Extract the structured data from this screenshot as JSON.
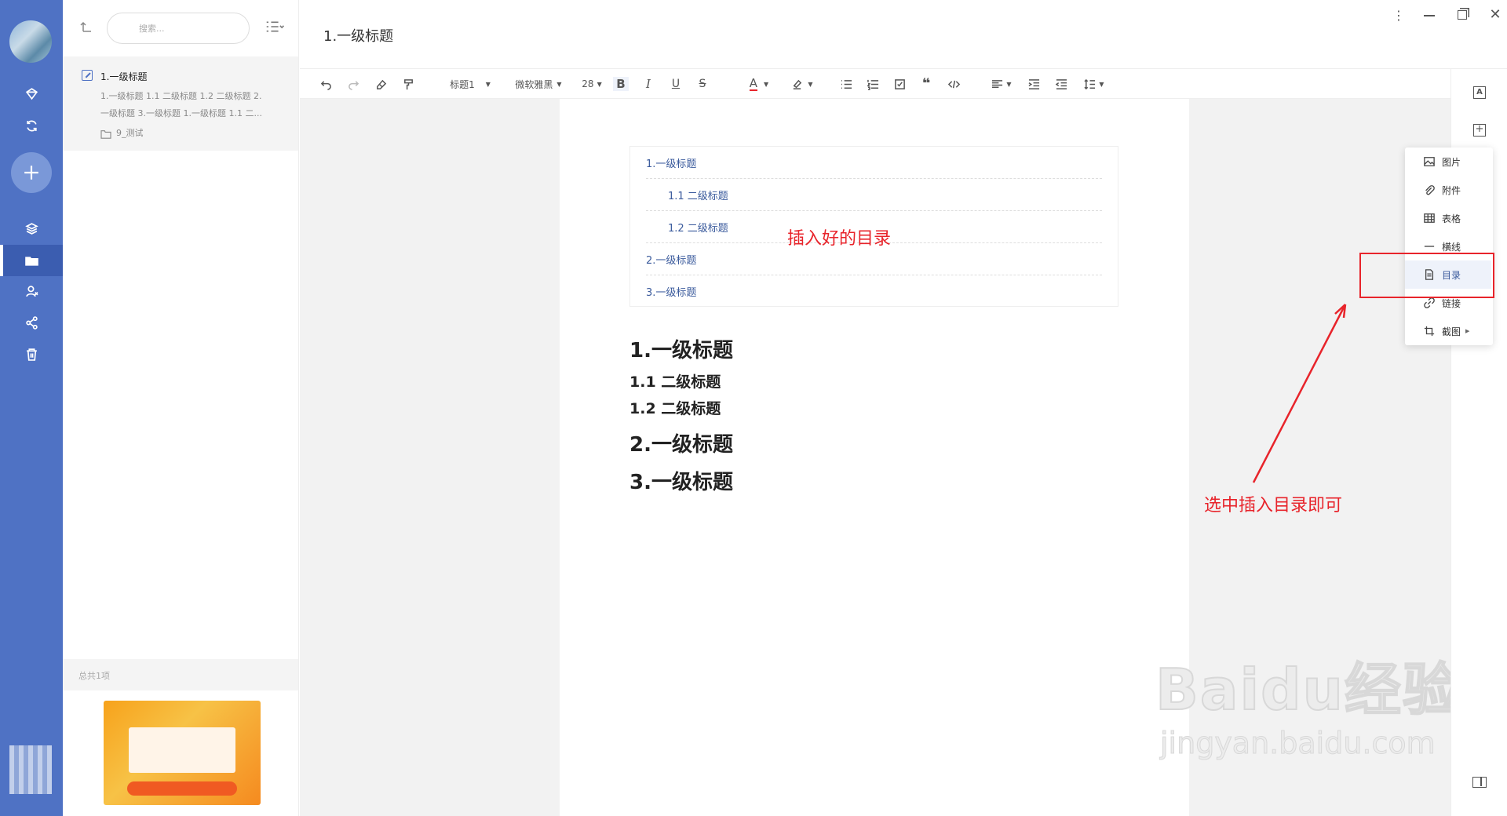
{
  "sidebar": {
    "items": [
      "favorites",
      "sync",
      "layers",
      "folder",
      "contacts",
      "share",
      "trash"
    ]
  },
  "notelist": {
    "search_placeholder": "搜索...",
    "note": {
      "title": "1.一级标题",
      "preview_line1": "1.一级标题 1.1 二级标题 1.2 二级标题 2.",
      "preview_line2": "一级标题 3.一级标题 1.一级标题 1.1 二...",
      "folder": "9_测试"
    },
    "total": "总共1项"
  },
  "document": {
    "title": "1.一级标题"
  },
  "toolbar": {
    "heading": "标题1",
    "font": "微软雅黑",
    "size": "28",
    "bold": "B",
    "italic": "I",
    "underline": "U",
    "strike": "S",
    "font_color": "A"
  },
  "toc": {
    "items": [
      "1.一级标题",
      "1.1 二级标题",
      "1.2 二级标题",
      "2.一级标题",
      "3.一级标题"
    ]
  },
  "headings": {
    "h1a": "1.一级标题",
    "h2a": "1.1 二级标题",
    "h2b": "1.2 二级标题",
    "h1b": "2.一级标题",
    "h1c": "3.一级标题"
  },
  "insert_menu": {
    "image": "图片",
    "attachment": "附件",
    "table": "表格",
    "hline": "横线",
    "toc": "目录",
    "link": "链接",
    "screenshot": "截图"
  },
  "annotations": {
    "toc_inserted": "插入好的目录",
    "select_toc": "选中插入目录即可"
  },
  "watermark": {
    "brand": "Baidu经验",
    "url": "jingyan.baidu.com"
  },
  "colors": {
    "rail": "#4f72c4",
    "annotation": "#e8242b",
    "accent": "#3a5a9c"
  }
}
